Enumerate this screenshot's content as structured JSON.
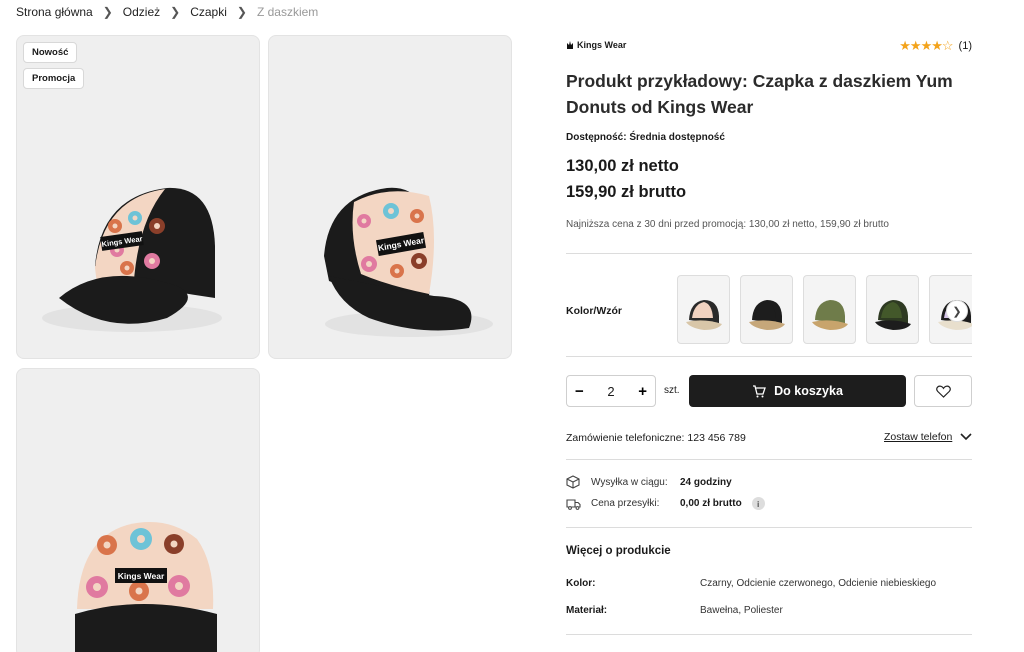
{
  "breadcrumb": [
    "Strona główna",
    "Odzież",
    "Czapki",
    "Z daszkiem"
  ],
  "badges": {
    "new": "Nowość",
    "promo": "Promocja"
  },
  "product": {
    "brand": "Kings Wear",
    "rating_count": "(1)",
    "rating_stars": 4,
    "title": "Produkt przykładowy: Czapka z daszkiem Yum Donuts od Kings Wear",
    "availability_label": "Dostępność:",
    "availability_value": "Średnia dostępność",
    "price_net": "130,00 zł netto",
    "price_gross": "159,90 zł brutto",
    "lowest_price_note": "Najniższa cena z 30 dni przed promocją: 130,00 zł netto, 159,90 zł brutto",
    "cap_print": "Kings Wear"
  },
  "variants": {
    "label": "Kolor/Wzór",
    "swatches": [
      {
        "name": "swatch-1",
        "crown": "#2a2a2a",
        "brim": "#d8c6a8",
        "front": "#f1d2c0"
      },
      {
        "name": "swatch-2",
        "crown": "#1d1d1d",
        "brim": "#c6a77a",
        "front": "#1d1d1d"
      },
      {
        "name": "swatch-3",
        "crown": "#6f7c4a",
        "brim": "#c8a46c",
        "front": "#6f7c4a"
      },
      {
        "name": "swatch-4",
        "crown": "#2e3a22",
        "brim": "#1d1d1d",
        "front": "#43582a"
      },
      {
        "name": "swatch-5",
        "crown": "#1d1d1d",
        "brim": "#e8dfcd",
        "front": "#d6c4e8"
      }
    ]
  },
  "cart": {
    "qty_minus": "−",
    "qty_value": "2",
    "qty_plus": "+",
    "unit": "szt.",
    "add_label": "Do koszyka"
  },
  "phone": {
    "order_text": "Zamówienie telefoniczne: 123 456 789",
    "callback_label": "Zostaw telefon"
  },
  "shipping": {
    "time_label": "Wysyłka w ciągu:",
    "time_value": "24 godziny",
    "cost_label": "Cena przesyłki:",
    "cost_value": "0,00 zł brutto",
    "info": "i"
  },
  "details": {
    "title": "Więcej o produkcie",
    "attributes": [
      {
        "key": "Kolor:",
        "value": "Czarny, Odcienie czerwonego, Odcienie niebieskiego"
      },
      {
        "key": "Materiał:",
        "value": "Bawełna, Poliester"
      }
    ]
  },
  "colors": {
    "accent": "#1d1d1d",
    "stars": "#f3a31b",
    "cap_front": "#f3d6c3",
    "cap_black": "#1b1b1b"
  }
}
